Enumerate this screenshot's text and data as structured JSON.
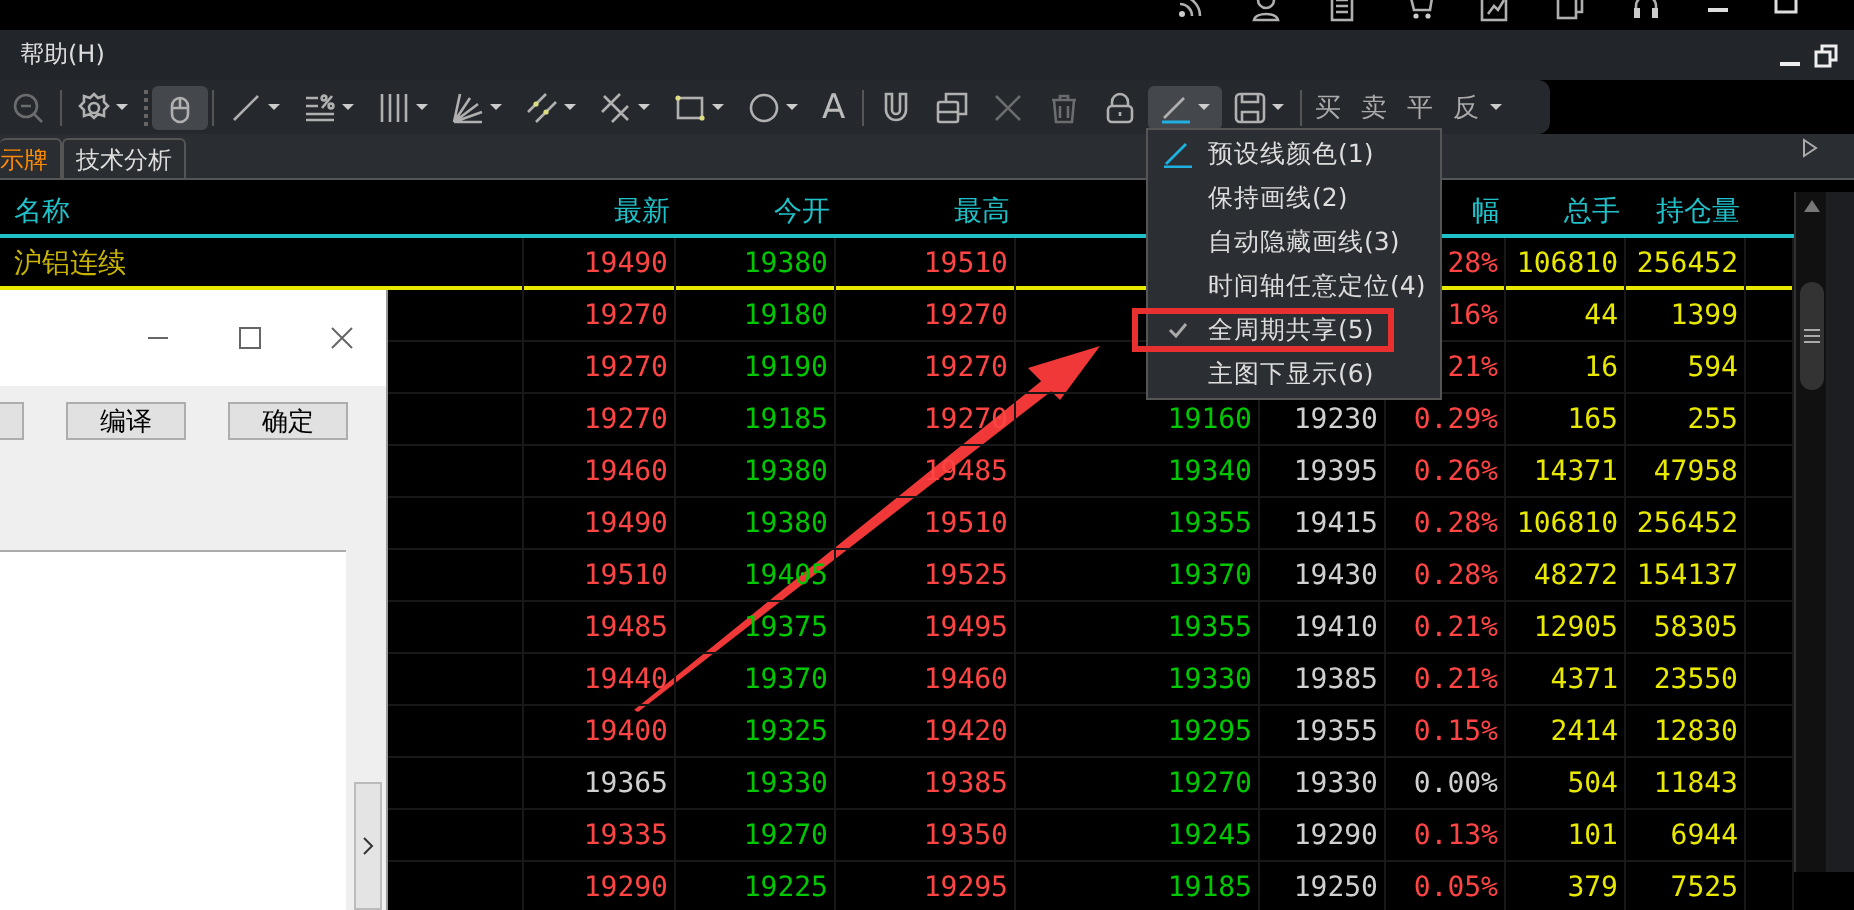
{
  "menu_bar": {
    "items": [
      "帮助(H)"
    ]
  },
  "toolbar": {
    "tools": [
      {
        "selected": false,
        "dropdown": false,
        "disabled": true
      },
      {
        "selected": false,
        "dropdown": true,
        "disabled": false
      },
      {
        "selected": true,
        "dropdown": false,
        "disabled": false
      },
      {
        "selected": false,
        "dropdown": true,
        "disabled": false
      },
      {
        "selected": false,
        "dropdown": true,
        "disabled": false
      },
      {
        "selected": false,
        "dropdown": true,
        "disabled": false
      },
      {
        "selected": false,
        "dropdown": true,
        "disabled": false
      },
      {
        "selected": false,
        "dropdown": true,
        "disabled": false
      },
      {
        "selected": false,
        "dropdown": true,
        "disabled": false
      },
      {
        "selected": false,
        "dropdown": true,
        "disabled": false
      },
      {
        "selected": false,
        "dropdown": true,
        "disabled": false
      },
      {
        "selected": false,
        "dropdown": false,
        "disabled": false,
        "glyph": "A"
      },
      {
        "selected": false,
        "dropdown": false,
        "disabled": false
      },
      {
        "selected": false,
        "dropdown": false,
        "disabled": false
      },
      {
        "selected": false,
        "dropdown": false,
        "disabled": true
      },
      {
        "selected": false,
        "dropdown": false,
        "disabled": true
      },
      {
        "selected": false,
        "dropdown": false,
        "disabled": false
      },
      {
        "selected": true,
        "dropdown": true,
        "disabled": false
      },
      {
        "selected": false,
        "dropdown": true,
        "disabled": false
      }
    ],
    "trade_buttons": [
      "买",
      "卖",
      "平",
      "反"
    ]
  },
  "tabs": [
    {
      "label": "示牌",
      "selected": true
    },
    {
      "label": "技术分析",
      "selected": false
    }
  ],
  "table": {
    "name_column": "名称",
    "columns": [
      "最新",
      "今开",
      "最高",
      null,
      null,
      "幅",
      "总手",
      "持仓量"
    ],
    "rows": [
      {
        "name": "沪铝连续",
        "cells": [
          {
            "text": "19490",
            "color": "#ff4444"
          },
          {
            "text": "19380",
            "color": "#00c800"
          },
          {
            "text": "19510",
            "color": "#ff4444"
          },
          null,
          null,
          {
            "text": "28%",
            "color": "#ff4444"
          },
          {
            "text": "106810",
            "color": "#e8e800"
          },
          {
            "text": "256452",
            "color": "#e8e800"
          }
        ]
      },
      {
        "name": null,
        "cells": [
          {
            "text": "19270",
            "color": "#ff4444"
          },
          {
            "text": "19180",
            "color": "#00c800"
          },
          {
            "text": "19270",
            "color": "#ff4444"
          },
          null,
          null,
          {
            "text": "16%",
            "color": "#ff4444"
          },
          {
            "text": "44",
            "color": "#e8e800"
          },
          {
            "text": "1399",
            "color": "#e8e800"
          }
        ]
      },
      {
        "name": null,
        "cells": [
          {
            "text": "19270",
            "color": "#ff4444"
          },
          {
            "text": "19190",
            "color": "#00c800"
          },
          {
            "text": "19270",
            "color": "#ff4444"
          },
          null,
          null,
          {
            "text": "21%",
            "color": "#ff4444"
          },
          {
            "text": "16",
            "color": "#e8e800"
          },
          {
            "text": "594",
            "color": "#e8e800"
          }
        ]
      },
      {
        "name": null,
        "cells": [
          {
            "text": "19270",
            "color": "#ff4444"
          },
          {
            "text": "19185",
            "color": "#00c800"
          },
          {
            "text": "19270",
            "color": "#ff4444"
          },
          {
            "text": "19160",
            "color": "#00c800"
          },
          {
            "text": "19230",
            "color": "#d0d0d0"
          },
          {
            "text": "0.29%",
            "color": "#ff4444"
          },
          {
            "text": "165",
            "color": "#e8e800"
          },
          {
            "text": "255",
            "color": "#e8e800"
          }
        ]
      },
      {
        "name": null,
        "cells": [
          {
            "text": "19460",
            "color": "#ff4444"
          },
          {
            "text": "19380",
            "color": "#00c800"
          },
          {
            "text": "19485",
            "color": "#ff4444"
          },
          {
            "text": "19340",
            "color": "#00c800"
          },
          {
            "text": "19395",
            "color": "#d0d0d0"
          },
          {
            "text": "0.26%",
            "color": "#ff4444"
          },
          {
            "text": "14371",
            "color": "#e8e800"
          },
          {
            "text": "47958",
            "color": "#e8e800"
          }
        ]
      },
      {
        "name": null,
        "cells": [
          {
            "text": "19490",
            "color": "#ff4444"
          },
          {
            "text": "19380",
            "color": "#00c800"
          },
          {
            "text": "19510",
            "color": "#ff4444"
          },
          {
            "text": "19355",
            "color": "#00c800"
          },
          {
            "text": "19415",
            "color": "#d0d0d0"
          },
          {
            "text": "0.28%",
            "color": "#ff4444"
          },
          {
            "text": "106810",
            "color": "#e8e800"
          },
          {
            "text": "256452",
            "color": "#e8e800"
          }
        ]
      },
      {
        "name": null,
        "cells": [
          {
            "text": "19510",
            "color": "#ff4444"
          },
          {
            "text": "19405",
            "color": "#00c800"
          },
          {
            "text": "19525",
            "color": "#ff4444"
          },
          {
            "text": "19370",
            "color": "#00c800"
          },
          {
            "text": "19430",
            "color": "#d0d0d0"
          },
          {
            "text": "0.28%",
            "color": "#ff4444"
          },
          {
            "text": "48272",
            "color": "#e8e800"
          },
          {
            "text": "154137",
            "color": "#e8e800"
          }
        ]
      },
      {
        "name": null,
        "cells": [
          {
            "text": "19485",
            "color": "#ff4444"
          },
          {
            "text": "19375",
            "color": "#00c800"
          },
          {
            "text": "19495",
            "color": "#ff4444"
          },
          {
            "text": "19355",
            "color": "#00c800"
          },
          {
            "text": "19410",
            "color": "#d0d0d0"
          },
          {
            "text": "0.21%",
            "color": "#ff4444"
          },
          {
            "text": "12905",
            "color": "#e8e800"
          },
          {
            "text": "58305",
            "color": "#e8e800"
          }
        ]
      },
      {
        "name": null,
        "cells": [
          {
            "text": "19440",
            "color": "#ff4444"
          },
          {
            "text": "19370",
            "color": "#00c800"
          },
          {
            "text": "19460",
            "color": "#ff4444"
          },
          {
            "text": "19330",
            "color": "#00c800"
          },
          {
            "text": "19385",
            "color": "#d0d0d0"
          },
          {
            "text": "0.21%",
            "color": "#ff4444"
          },
          {
            "text": "4371",
            "color": "#e8e800"
          },
          {
            "text": "23550",
            "color": "#e8e800"
          }
        ]
      },
      {
        "name": null,
        "cells": [
          {
            "text": "19400",
            "color": "#ff4444"
          },
          {
            "text": "19325",
            "color": "#00c800"
          },
          {
            "text": "19420",
            "color": "#ff4444"
          },
          {
            "text": "19295",
            "color": "#00c800"
          },
          {
            "text": "19355",
            "color": "#d0d0d0"
          },
          {
            "text": "0.15%",
            "color": "#ff4444"
          },
          {
            "text": "2414",
            "color": "#e8e800"
          },
          {
            "text": "12830",
            "color": "#e8e800"
          }
        ]
      },
      {
        "name": null,
        "cells": [
          {
            "text": "19365",
            "color": "#d0d0d0"
          },
          {
            "text": "19330",
            "color": "#00c800"
          },
          {
            "text": "19385",
            "color": "#ff4444"
          },
          {
            "text": "19270",
            "color": "#00c800"
          },
          {
            "text": "19330",
            "color": "#d0d0d0"
          },
          {
            "text": "0.00%",
            "color": "#d0d0d0"
          },
          {
            "text": "504",
            "color": "#e8e800"
          },
          {
            "text": "11843",
            "color": "#e8e800"
          }
        ]
      },
      {
        "name": null,
        "cells": [
          {
            "text": "19335",
            "color": "#ff4444"
          },
          {
            "text": "19270",
            "color": "#00c800"
          },
          {
            "text": "19350",
            "color": "#ff4444"
          },
          {
            "text": "19245",
            "color": "#00c800"
          },
          {
            "text": "19290",
            "color": "#d0d0d0"
          },
          {
            "text": "0.13%",
            "color": "#ff4444"
          },
          {
            "text": "101",
            "color": "#e8e800"
          },
          {
            "text": "6944",
            "color": "#e8e800"
          }
        ]
      },
      {
        "name": null,
        "cells": [
          {
            "text": "19290",
            "color": "#ff4444"
          },
          {
            "text": "19225",
            "color": "#00c800"
          },
          {
            "text": "19295",
            "color": "#ff4444"
          },
          {
            "text": "19185",
            "color": "#00c800"
          },
          {
            "text": "19250",
            "color": "#d0d0d0"
          },
          {
            "text": "0.05%",
            "color": "#ff4444"
          },
          {
            "text": "379",
            "color": "#e8e800"
          },
          {
            "text": "7525",
            "color": "#e8e800"
          }
        ]
      }
    ]
  },
  "dropdown_menu": {
    "items": [
      {
        "kind": "color",
        "label": "预设线颜色(1)",
        "checked": false,
        "highlighted": false
      },
      {
        "kind": "option",
        "label": "保持画线(2)",
        "checked": false,
        "highlighted": false
      },
      {
        "kind": "option",
        "label": "自动隐藏画线(3)",
        "checked": false,
        "highlighted": false
      },
      {
        "kind": "option",
        "label": "时间轴任意定位(4)",
        "checked": false,
        "highlighted": false
      },
      {
        "kind": "option",
        "label": "全周期共享(5)",
        "checked": true,
        "highlighted": true
      },
      {
        "kind": "option",
        "label": "主图下显示(6)",
        "checked": false,
        "highlighted": false
      }
    ]
  },
  "dialog": {
    "buttons": [
      "编译",
      "确定"
    ]
  }
}
